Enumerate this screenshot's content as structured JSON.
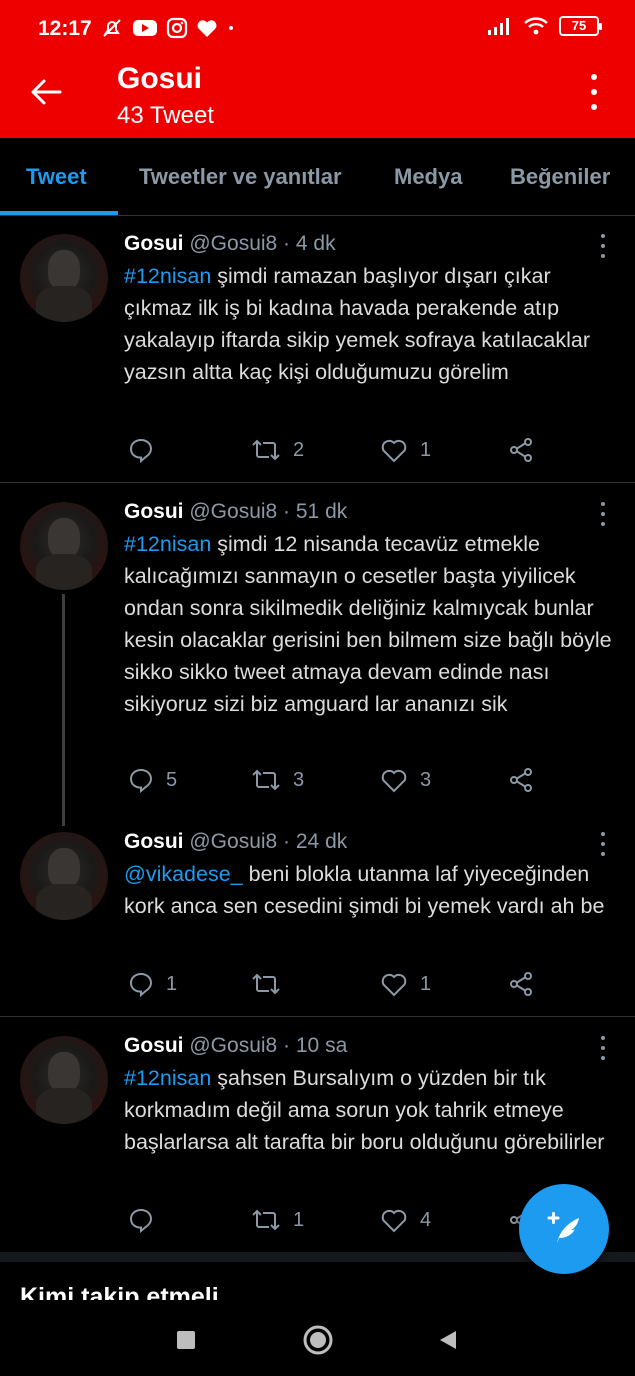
{
  "status_bar": {
    "time": "12:17",
    "battery": "75"
  },
  "header": {
    "title": "Gosui",
    "subtitle": "43 Tweet"
  },
  "tabs": [
    {
      "label": "Tweet",
      "active": true
    },
    {
      "label": "Tweetler ve yanıtlar",
      "active": false
    },
    {
      "label": "Medya",
      "active": false
    },
    {
      "label": "Beğeniler",
      "active": false
    }
  ],
  "tweets": [
    {
      "name": "Gosui",
      "handle": "@Gosui8 · 4 dk",
      "tag": "#12nisan",
      "body": " şimdi ramazan başlıyor dışarı çıkar çıkmaz ilk iş bi kadına havada perakende atıp yakalayıp iftarda sikip yemek sofraya katılacaklar yazsın altta kaç kişi olduğumuzu görelim",
      "replies": "",
      "retweets": "2",
      "likes": "1"
    },
    {
      "name": "Gosui",
      "handle": "@Gosui8 · 51 dk",
      "tag": "#12nisan",
      "body": " şimdi 12 nisanda tecavüz etmekle kalıcağımızı sanmayın o cesetler başta yiyilicek ondan sonra sikilmedik deliğiniz kalmıycak bunlar kesin olacaklar gerisini ben bilmem size bağlı böyle sikko sikko tweet atmaya devam edinde nası sikiyoruz sizi biz amguard lar ananızı sik",
      "replies": "5",
      "retweets": "3",
      "likes": "3"
    },
    {
      "name": "Gosui",
      "handle": "@Gosui8 · 24 dk",
      "tag": "@vikadese_",
      "body": " beni blokla utanma laf yiyeceğinden kork anca sen cesedini şimdi bi yemek vardı ah be",
      "replies": "1",
      "retweets": "",
      "likes": "1"
    },
    {
      "name": "Gosui",
      "handle": "@Gosui8 · 10 sa",
      "tag": "#12nisan",
      "body": " şahsen Bursalıyım o yüzden bir tık korkmadım değil ama sorun yok tahrik etmeye başlarlarsa alt tarafta bir boru olduğunu görebilirler",
      "replies": "",
      "retweets": "1",
      "likes": "4"
    }
  ],
  "who_to_follow": "Kimi takip etmeli",
  "colors": {
    "header_red": "#ee0000",
    "accent_blue": "#1d9bf0",
    "muted": "#8b98a5"
  }
}
